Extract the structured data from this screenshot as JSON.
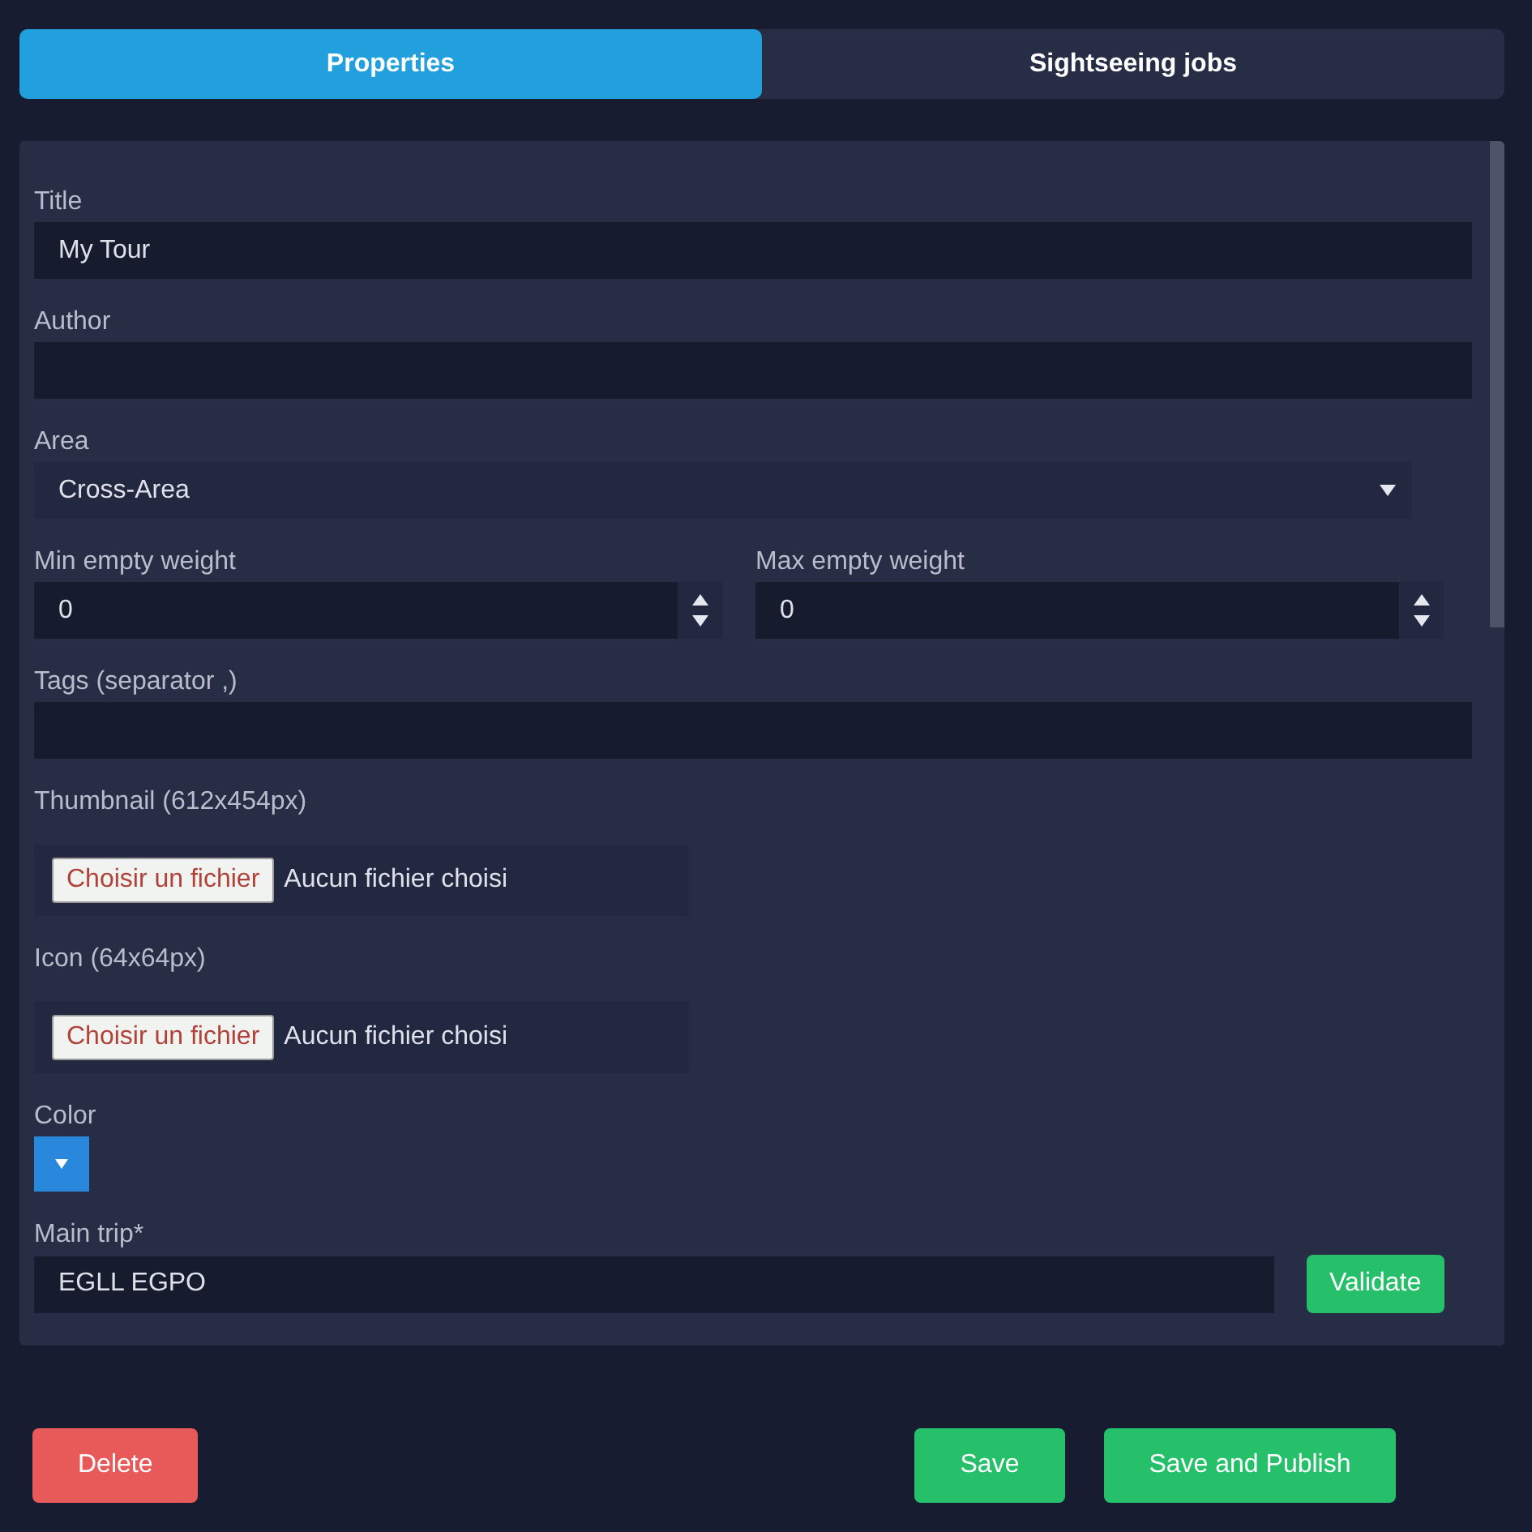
{
  "tabs": [
    {
      "label": "Properties",
      "selected": true
    },
    {
      "label": "Sightseeing jobs",
      "selected": false
    }
  ],
  "fields": [
    {
      "kind": "text",
      "label": "Title",
      "value": "My Tour"
    },
    {
      "kind": "text",
      "label": "Author"
    },
    {
      "kind": "select",
      "label": "Area",
      "value": "Cross-Area"
    },
    {
      "kind": "number_pair",
      "items": [
        {
          "label": "Min empty weight",
          "value": "0"
        },
        {
          "label": "Max empty weight",
          "value": "0"
        }
      ]
    },
    {
      "kind": "text",
      "label": "Tags (separator ,)"
    },
    {
      "kind": "file",
      "label": "Thumbnail (612x454px)",
      "button": "Choisir un fichier",
      "status": "Aucun fichier choisi"
    },
    {
      "kind": "file",
      "label": "Icon (64x64px)",
      "button": "Choisir un fichier",
      "status": "Aucun fichier choisi"
    },
    {
      "kind": "color",
      "label": "Color",
      "color": "#2a88dc"
    },
    {
      "kind": "trip",
      "label": "Main trip*",
      "value": "EGLL EGPO",
      "button": "Validate"
    }
  ],
  "buttons": [
    {
      "label": "Delete",
      "kind": "danger"
    },
    {
      "label": "Save",
      "kind": "success"
    },
    {
      "label": "Save and Publish",
      "kind": "success"
    }
  ]
}
